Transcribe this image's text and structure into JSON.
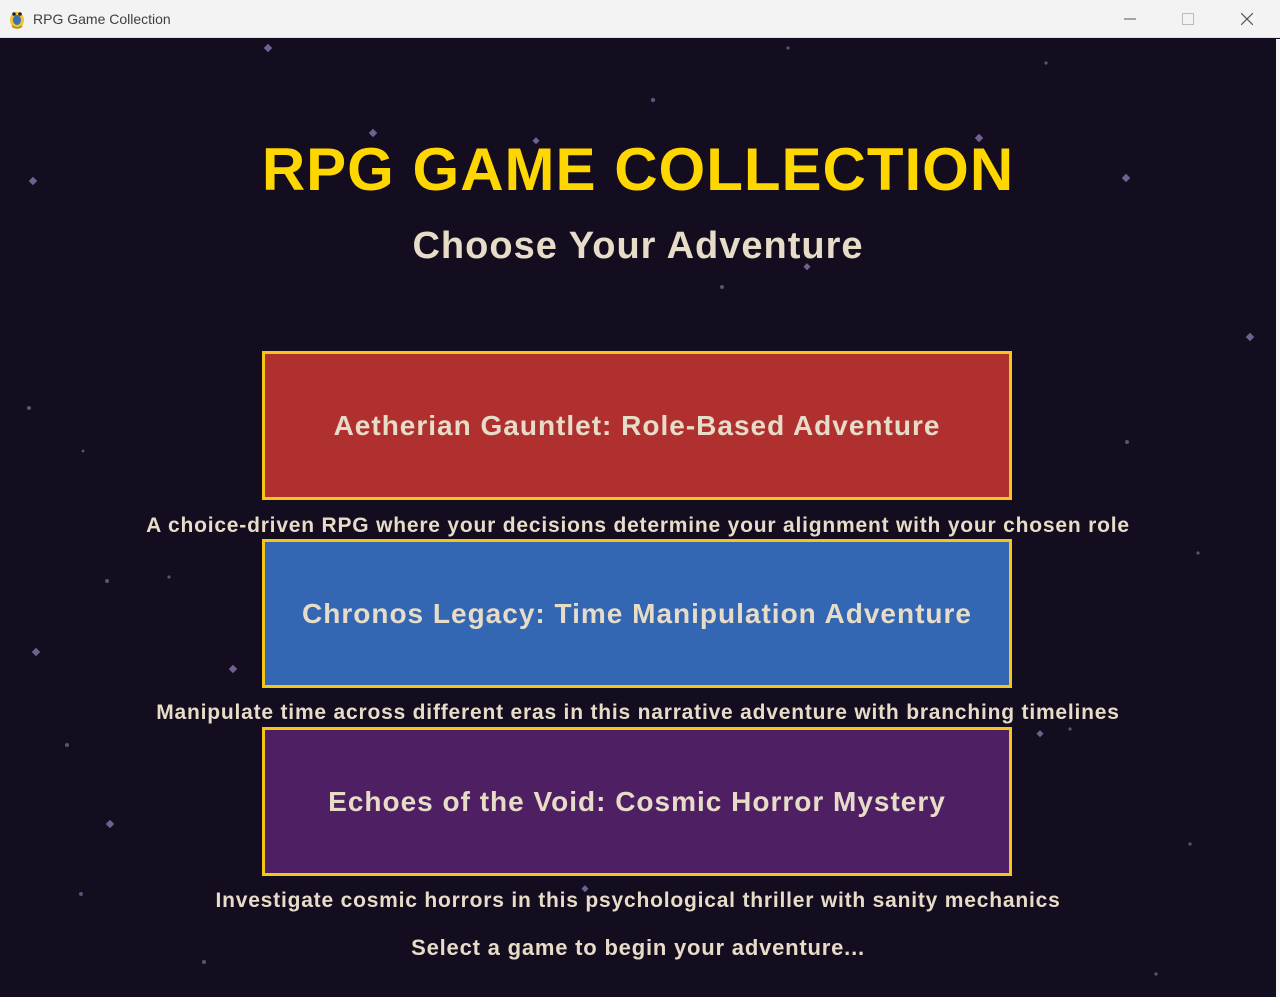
{
  "window": {
    "title": "RPG Game Collection",
    "controls": {
      "minimize": "minimize-icon",
      "maximize": "maximize-icon",
      "close": "close-icon"
    }
  },
  "menu": {
    "title": "RPG GAME COLLECTION",
    "subtitle": "Choose Your Adventure",
    "games": [
      {
        "label": "Aetherian Gauntlet: Role-Based Adventure",
        "description": "A choice-driven RPG where your decisions determine your alignment with your chosen role",
        "color": "#b03030"
      },
      {
        "label": "Chronos Legacy: Time Manipulation Adventure",
        "description": "Manipulate time across different eras in this narrative adventure with branching timelines",
        "color": "#3366b3"
      },
      {
        "label": "Echoes of the Void: Cosmic Horror Mystery",
        "description": "Investigate cosmic horrors in this psychological thriller with sanity mechanics",
        "color": "#4f1f63"
      }
    ],
    "prompt": "Select a game to begin your adventure..."
  },
  "colors": {
    "background": "#140c1f",
    "title": "#ffd700",
    "text": "#e6dcc8",
    "card_border": "#f5c518",
    "star": "#7a6a9a"
  },
  "icons": {
    "app": "python-snake-icon",
    "stars": "star-dot-icon"
  }
}
